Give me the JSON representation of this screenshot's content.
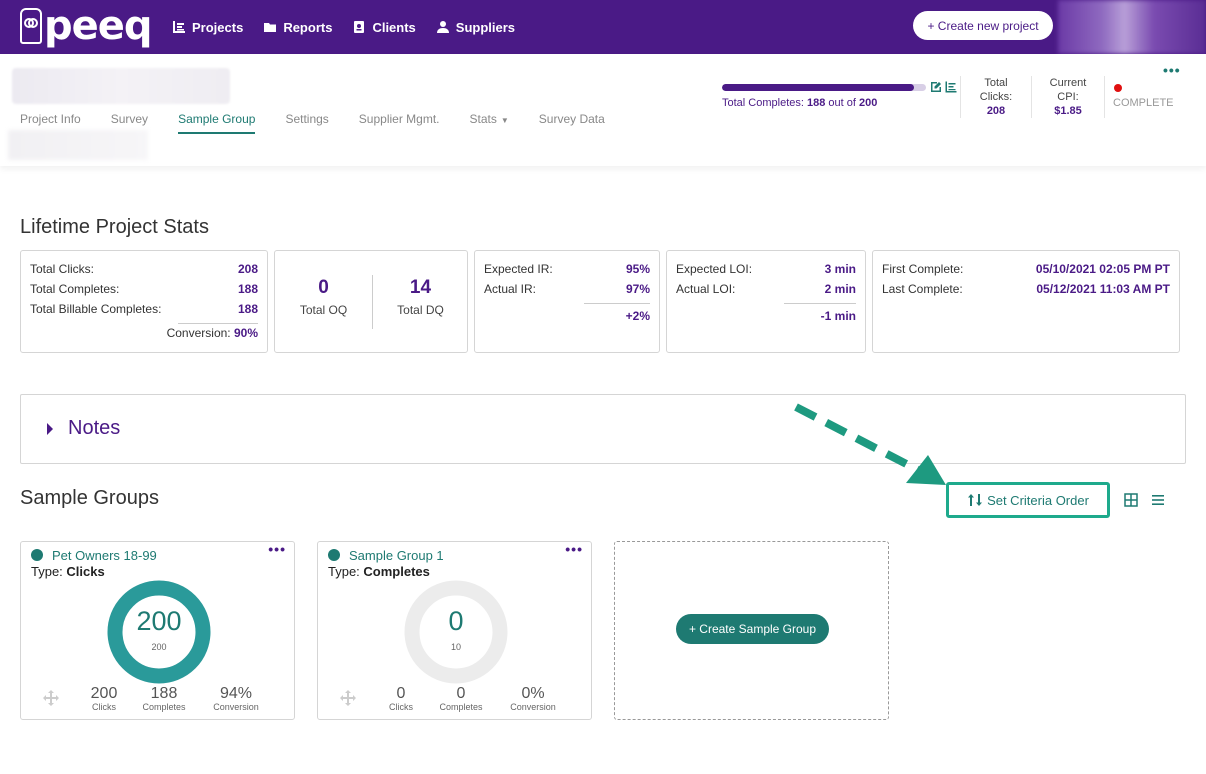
{
  "brand": {
    "logo_text": "peeq",
    "primary": "#4a1a86",
    "accent": "#1e7a72",
    "highlight": "#1eaa8c"
  },
  "nav": {
    "items": [
      {
        "label": "Projects",
        "icon": "chart-icon"
      },
      {
        "label": "Reports",
        "icon": "folder-icon"
      },
      {
        "label": "Clients",
        "icon": "contact-card-icon"
      },
      {
        "label": "Suppliers",
        "icon": "user-icon"
      }
    ],
    "create_project_label": "+ Create new project"
  },
  "project": {
    "tabs": [
      "Project Info",
      "Survey",
      "Sample Group",
      "Settings",
      "Supplier Mgmt.",
      "Stats",
      "Survey Data"
    ],
    "active_tab": "Sample Group",
    "progress": {
      "fraction": 0.94,
      "label": "Total Completes:",
      "completes": "188",
      "out_of": "out of",
      "total": "200"
    },
    "total_clicks": {
      "label1": "Total",
      "label2": "Clicks:",
      "value": "208"
    },
    "current_cpi": {
      "label1": "Current",
      "label2": "CPI:",
      "value": "$1.85"
    },
    "status": "COMPLETE"
  },
  "lifetime": {
    "title": "Lifetime Project Stats",
    "card1": {
      "rows": [
        {
          "label": "Total Clicks:",
          "value": "208"
        },
        {
          "label": "Total Completes:",
          "value": "188"
        },
        {
          "label": "Total Billable Completes:",
          "value": "188"
        }
      ],
      "conversion_label": "Conversion:",
      "conversion_value": "90%"
    },
    "card2": {
      "oq_value": "0",
      "oq_label": "Total OQ",
      "dq_value": "14",
      "dq_label": "Total DQ"
    },
    "card3": {
      "rows": [
        {
          "label": "Expected IR:",
          "value": "95%"
        },
        {
          "label": "Actual IR:",
          "value": "97%"
        }
      ],
      "diff": "+2%"
    },
    "card4": {
      "rows": [
        {
          "label": "Expected LOI:",
          "value": "3 min"
        },
        {
          "label": "Actual LOI:",
          "value": "2 min"
        }
      ],
      "diff": "-1 min"
    },
    "card5": {
      "rows": [
        {
          "label": "First Complete:",
          "value": "05/10/2021 02:05 PM PT"
        },
        {
          "label": "Last Complete:",
          "value": "05/12/2021 11:03 AM PT"
        }
      ]
    }
  },
  "notes": {
    "label": "Notes"
  },
  "sample_groups": {
    "title": "Sample Groups",
    "set_criteria_label": "Set Criteria Order",
    "groups": [
      {
        "name": "Pet Owners 18-99",
        "type_label": "Type:",
        "type": "Clicks",
        "donut_value": "200",
        "donut_target": "200",
        "fill_fraction": 1.0,
        "stats": [
          {
            "value": "200",
            "label": "Clicks"
          },
          {
            "value": "188",
            "label": "Completes"
          },
          {
            "value": "94%",
            "label": "Conversion"
          }
        ]
      },
      {
        "name": "Sample Group 1",
        "type_label": "Type:",
        "type": "Completes",
        "donut_value": "0",
        "donut_target": "10",
        "fill_fraction": 0.0,
        "stats": [
          {
            "value": "0",
            "label": "Clicks"
          },
          {
            "value": "0",
            "label": "Completes"
          },
          {
            "value": "0%",
            "label": "Conversion"
          }
        ]
      }
    ],
    "create_label": "+ Create Sample Group"
  }
}
